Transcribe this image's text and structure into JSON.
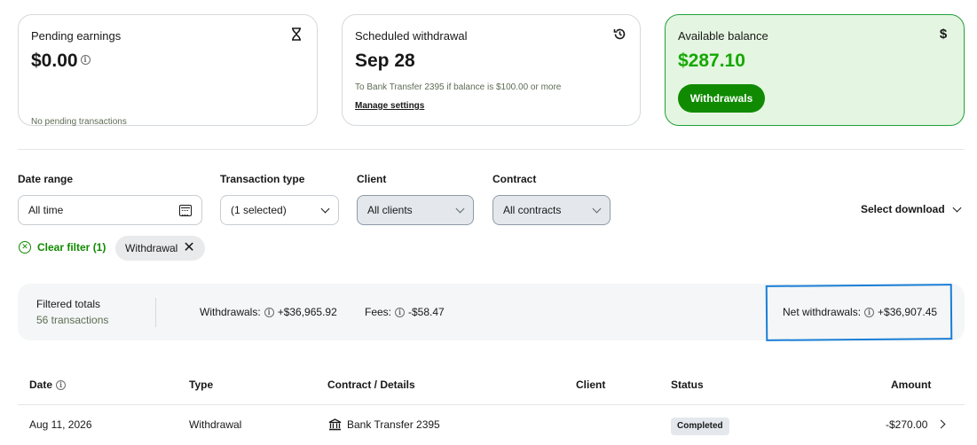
{
  "cards": {
    "pending": {
      "label": "Pending earnings",
      "value": "$0.00",
      "sub": "No pending transactions",
      "icon": "hourglass-icon"
    },
    "scheduled": {
      "label": "Scheduled withdrawal",
      "value": "Sep 28",
      "sub": "To Bank Transfer 2395 if balance is $100.00 or more",
      "link": "Manage settings",
      "icon": "history-icon"
    },
    "available": {
      "label": "Available balance",
      "value": "$287.10",
      "button": "Withdrawals",
      "icon": "dollar-icon"
    }
  },
  "filters": {
    "date_range": {
      "label": "Date range",
      "value": "All time"
    },
    "transaction_type": {
      "label": "Transaction type",
      "value": "(1 selected)"
    },
    "client": {
      "label": "Client",
      "value": "All clients"
    },
    "contract": {
      "label": "Contract",
      "value": "All contracts"
    },
    "select_download": "Select download",
    "clear_filter": "Clear filter (1)",
    "chip": "Withdrawal"
  },
  "totals": {
    "title": "Filtered totals",
    "count": "56 transactions",
    "withdrawals_label": "Withdrawals:",
    "withdrawals_value": "+$36,965.92",
    "fees_label": "Fees:",
    "fees_value": "-$58.47",
    "net_label": "Net withdrawals:",
    "net_value": "+$36,907.45"
  },
  "table": {
    "headers": {
      "date": "Date",
      "type": "Type",
      "contract": "Contract / Details",
      "client": "Client",
      "status": "Status",
      "amount": "Amount"
    },
    "rows": [
      {
        "date": "Aug 11, 2026",
        "type": "Withdrawal",
        "details": "Bank Transfer 2395",
        "client": "",
        "status": "Completed",
        "amount": "-$270.00"
      }
    ]
  },
  "colors": {
    "accent_green": "#108a00",
    "highlight_blue": "#1a7ed6"
  }
}
